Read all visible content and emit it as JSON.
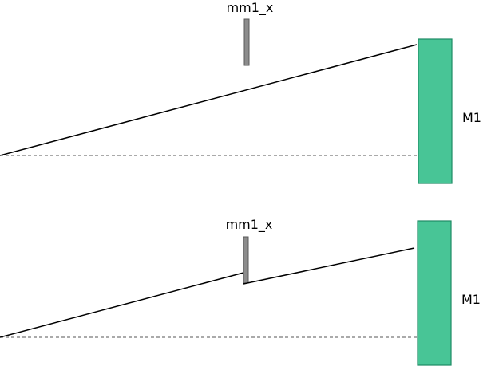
{
  "panels": [
    {
      "aperture_label": "mm1_x",
      "mirror_label": "M1",
      "beam_clipped": false
    },
    {
      "aperture_label": "mm1_x",
      "mirror_label": "M1",
      "beam_clipped": true
    }
  ],
  "colors": {
    "mirror_fill": "#48c596",
    "mirror_stroke": "#1e8a64",
    "aperture_fill": "#8c8c8c",
    "aperture_stroke": "#5a5a5a",
    "beam": "#000000",
    "axis": "#555555"
  }
}
